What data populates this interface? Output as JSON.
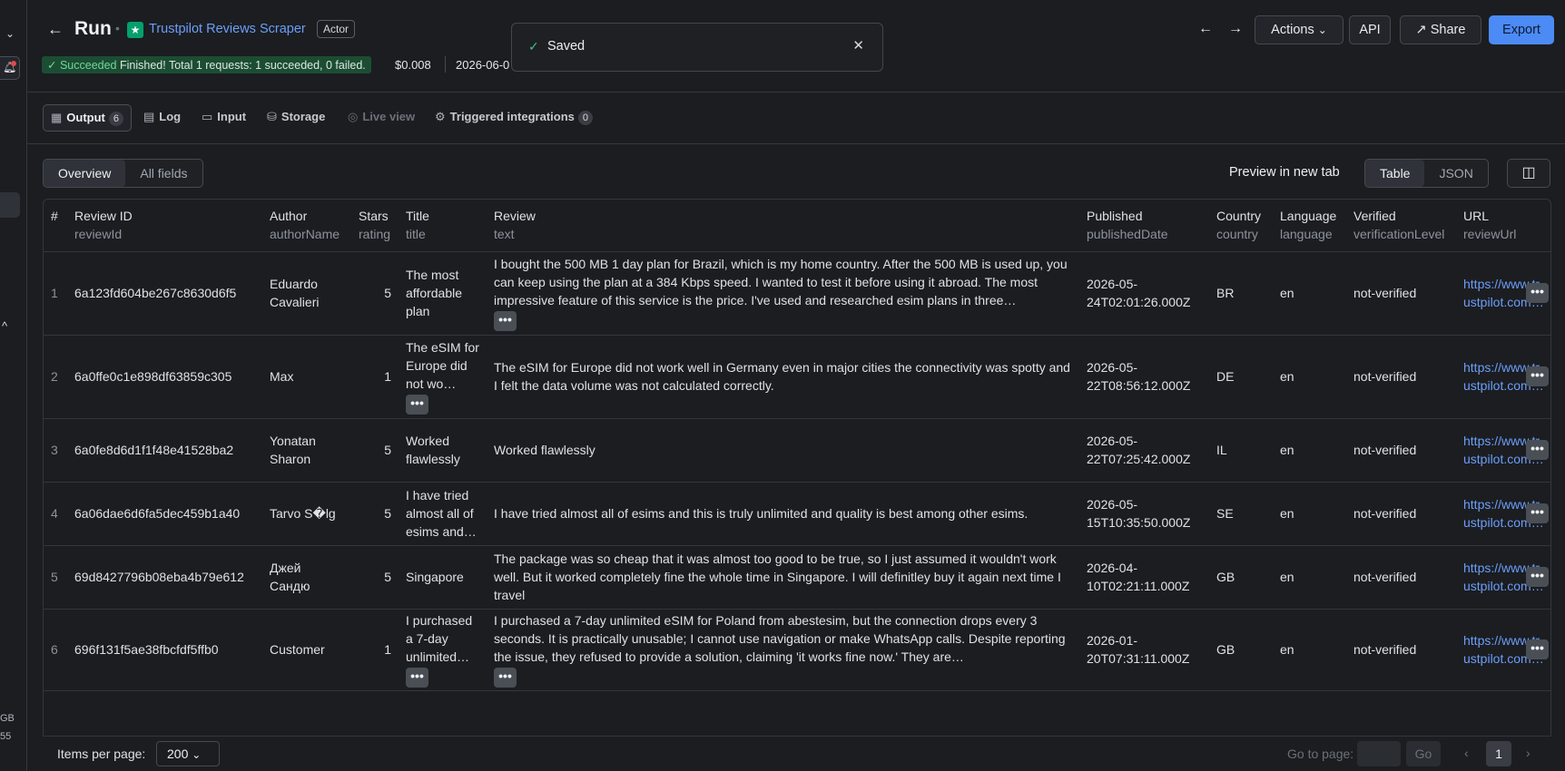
{
  "header": {
    "title": "Run",
    "actor_name": "Trustpilot Reviews Scraper",
    "actor_badge": "Actor",
    "status_label": "Succeeded",
    "status_message": "Finished! Total 1 requests: 1 succeeded, 0 failed.",
    "cost": "$0.008",
    "date": "2026-06-0",
    "actions_label": "Actions",
    "api_label": "API",
    "share_label": "Share",
    "export_label": "Export"
  },
  "toast": {
    "text": "Saved"
  },
  "left_strip": {
    "item1": "GB",
    "item2": "55"
  },
  "tabs": [
    {
      "label": "Output",
      "count": "6"
    },
    {
      "label": "Log"
    },
    {
      "label": "Input"
    },
    {
      "label": "Storage"
    },
    {
      "label": "Live view"
    },
    {
      "label": "Triggered integrations",
      "count": "0"
    }
  ],
  "view": {
    "overview_label": "Overview",
    "all_fields_label": "All fields",
    "preview_label": "Preview in new tab",
    "table_label": "Table",
    "json_label": "JSON"
  },
  "table": {
    "columns": [
      {
        "label": "#",
        "key": ""
      },
      {
        "label": "Review ID",
        "key": "reviewId"
      },
      {
        "label": "Author",
        "key": "authorName"
      },
      {
        "label": "Stars",
        "key": "rating"
      },
      {
        "label": "Title",
        "key": "title"
      },
      {
        "label": "Review",
        "key": "text"
      },
      {
        "label": "Published",
        "key": "publishedDate"
      },
      {
        "label": "Country",
        "key": "country"
      },
      {
        "label": "Language",
        "key": "language"
      },
      {
        "label": "Verified",
        "key": "verificationLevel"
      },
      {
        "label": "URL",
        "key": "reviewUrl"
      }
    ],
    "rows": [
      {
        "num": "1",
        "id": "6a123fd604be267c8630d6f5",
        "author": "Eduardo Cavalieri",
        "stars": "5",
        "title": "The most affordable plan",
        "review": "I bought the 500 MB 1 day plan for Brazil, which is my home country. After the 500 MB is used up, you can keep using the plan at a 384 Kbps speed. I wanted to test it before using it abroad. The most impressive feature of this service is the price. I've used and researched esim plans in three…",
        "published": "2026-05-24T02:01:26.000Z",
        "country": "BR",
        "language": "en",
        "verified": "not-verified",
        "url": "https://www.trustpilot.com…"
      },
      {
        "num": "2",
        "id": "6a0ffe0c1e898df63859c305",
        "author": "Max",
        "stars": "1",
        "title": "The eSIM for Europe did not wo…",
        "review": "The eSIM for Europe did not work well in Germany even in major cities the connectivity was spotty and I felt the data volume was not calculated correctly.",
        "published": "2026-05-22T08:56:12.000Z",
        "country": "DE",
        "language": "en",
        "verified": "not-verified",
        "url": "https://www.trustpilot.com…"
      },
      {
        "num": "3",
        "id": "6a0fe8d6d1f1f48e41528ba2",
        "author": "Yonatan Sharon",
        "stars": "5",
        "title": "Worked flawlessly",
        "review": "Worked flawlessly",
        "published": "2026-05-22T07:25:42.000Z",
        "country": "IL",
        "language": "en",
        "verified": "not-verified",
        "url": "https://www.trustpilot.com…"
      },
      {
        "num": "4",
        "id": "6a06dae6d6fa5dec459b1a40",
        "author": "Tarvo S�lg",
        "stars": "5",
        "title": "I have tried almost all of esims and…",
        "review": "I have tried almost all of esims and this is truly unlimited and quality is best among other esims.",
        "published": "2026-05-15T10:35:50.000Z",
        "country": "SE",
        "language": "en",
        "verified": "not-verified",
        "url": "https://www.trustpilot.com…"
      },
      {
        "num": "5",
        "id": "69d8427796b08eba4b79e612",
        "author": "Джей Сандю",
        "stars": "5",
        "title": "Singapore",
        "review": "The package was so cheap that it was almost too good to be true, so I just assumed it wouldn't work well. But it worked completely fine the whole time in Singapore. I will definitley buy it again next time I travel",
        "published": "2026-04-10T02:21:11.000Z",
        "country": "GB",
        "language": "en",
        "verified": "not-verified",
        "url": "https://www.trustpilot.com…"
      },
      {
        "num": "6",
        "id": "696f131f5ae38fbcfdf5ffb0",
        "author": "Customer",
        "stars": "1",
        "title": "I purchased a 7-day unlimited…",
        "review": "I purchased a 7-day unlimited eSIM for Poland from abestesim, but the connection drops every 3 seconds. It is practically unusable; I cannot use navigation or make WhatsApp calls. Despite reporting the issue, they refused to provide a solution, claiming 'it works fine now.' They are…",
        "published": "2026-01-20T07:31:11.000Z",
        "country": "GB",
        "language": "en",
        "verified": "not-verified",
        "url": "https://www.trustpilot.com…"
      }
    ]
  },
  "footer": {
    "items_per_page_label": "Items per page:",
    "items_per_page_value": "200",
    "goto_label": "Go to page:",
    "go_label": "Go",
    "current_page": "1"
  },
  "more_glyph": "•••",
  "colors": {
    "accent": "#4c8bf5",
    "success_bg": "#1c4d33",
    "link": "#6c9ef8"
  }
}
